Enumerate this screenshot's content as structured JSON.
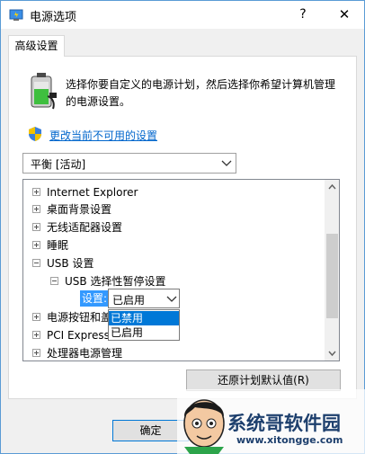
{
  "window": {
    "title": "电源选项",
    "help_glyph": "?",
    "close_glyph": "✕"
  },
  "tab": {
    "label": "高级设置"
  },
  "description": "选择你要自定义的电源计划，然后选择你希望计算机管理的电源设置。",
  "change_link": "更改当前不可用的设置",
  "plan_select": {
    "value": "平衡 [活动]"
  },
  "tree": {
    "items": [
      {
        "label": "Internet Explorer",
        "expander": "plus"
      },
      {
        "label": "桌面背景设置",
        "expander": "plus"
      },
      {
        "label": "无线适配器设置",
        "expander": "plus"
      },
      {
        "label": "睡眠",
        "expander": "plus"
      },
      {
        "label": "USB 设置",
        "expander": "minus"
      },
      {
        "label": "USB 选择性暂停设置",
        "expander": "minus"
      },
      {
        "label": "电源按钮和盖",
        "expander": "plus"
      },
      {
        "label": "PCI Express",
        "expander": "plus"
      },
      {
        "label": "处理器电源管理",
        "expander": "plus"
      }
    ],
    "setting_label": "设置:",
    "setting_value": "已启用",
    "dropdown_options": [
      "已禁用",
      "已启用"
    ],
    "dropdown_selected": "已禁用"
  },
  "buttons": {
    "restore": "还原计划默认值(R)",
    "ok": "确定"
  },
  "watermark": {
    "text": "系统哥软件园",
    "url": "www.xitongge.com"
  },
  "colors": {
    "accent": "#0078d7",
    "link": "#0066cc",
    "highlight": "#3399ff",
    "watermark": "#1d3f6d"
  },
  "icons": {
    "app": "power-options-icon",
    "battery": "battery-plug-icon",
    "shield": "uac-shield-icon"
  }
}
